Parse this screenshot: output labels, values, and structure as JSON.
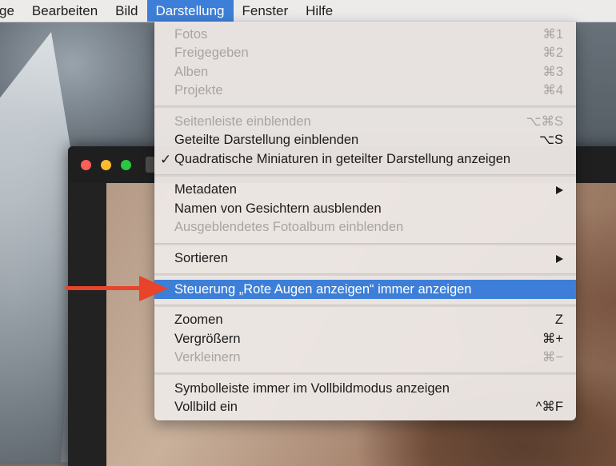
{
  "menubar": {
    "items": [
      {
        "label": "ge"
      },
      {
        "label": "Bearbeiten"
      },
      {
        "label": "Bild"
      },
      {
        "label": "Darstellung"
      },
      {
        "label": "Fenster"
      },
      {
        "label": "Hilfe"
      }
    ],
    "active_index": 3
  },
  "menu": {
    "sections": [
      [
        {
          "label": "Fotos",
          "shortcut": "⌘1",
          "enabled": false
        },
        {
          "label": "Freigegeben",
          "shortcut": "⌘2",
          "enabled": false
        },
        {
          "label": "Alben",
          "shortcut": "⌘3",
          "enabled": false
        },
        {
          "label": "Projekte",
          "shortcut": "⌘4",
          "enabled": false
        }
      ],
      [
        {
          "label": "Seitenleiste einblenden",
          "shortcut": "⌥⌘S",
          "enabled": false
        },
        {
          "label": "Geteilte Darstellung einblenden",
          "shortcut": "⌥S",
          "enabled": true
        },
        {
          "label": "Quadratische Miniaturen in geteilter Darstellung anzeigen",
          "checked": true,
          "check_mark": "✓",
          "enabled": true
        }
      ],
      [
        {
          "label": "Metadaten",
          "submenu": true,
          "enabled": true
        },
        {
          "label": "Namen von Gesichtern ausblenden",
          "enabled": true
        },
        {
          "label": "Ausgeblendetes Fotoalbum einblenden",
          "enabled": false
        }
      ],
      [
        {
          "label": "Sortieren",
          "submenu": true,
          "enabled": true
        }
      ],
      [
        {
          "label": "Steuerung „Rote Augen anzeigen“ immer anzeigen",
          "enabled": true,
          "highlighted": true
        }
      ],
      [
        {
          "label": "Zoomen",
          "shortcut": "Z",
          "enabled": true
        },
        {
          "label": "Vergrößern",
          "shortcut": "⌘+",
          "enabled": true
        },
        {
          "label": "Verkleinern",
          "shortcut": "⌘−",
          "enabled": false
        }
      ],
      [
        {
          "label": "Symbolleiste immer im Vollbildmodus anzeigen",
          "enabled": true
        },
        {
          "label": "Vollbild ein",
          "shortcut": "^⌘F",
          "enabled": true
        }
      ]
    ]
  },
  "colors": {
    "highlight": "#3d7fd8",
    "annotation_arrow": "#e8432b",
    "disabled_text": "#a7a4a2"
  }
}
